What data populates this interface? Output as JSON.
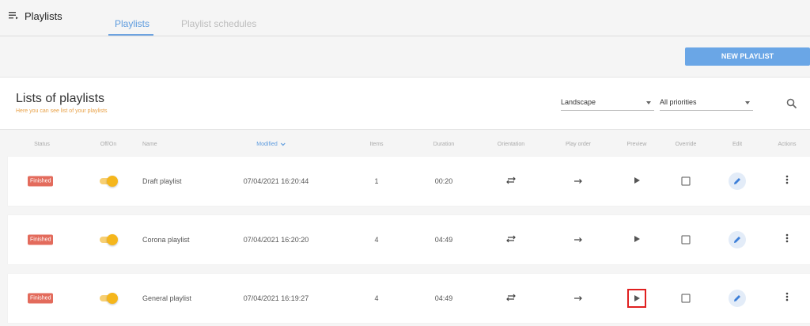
{
  "app": {
    "title": "Playlists"
  },
  "tabs": [
    {
      "label": "Playlists",
      "active": true
    },
    {
      "label": "Playlist schedules",
      "active": false
    }
  ],
  "toolbar": {
    "new_playlist_label": "NEW PLAYLIST"
  },
  "section": {
    "title": "Lists of playlists",
    "subtitle": "Here you can see list of your playlists"
  },
  "filters": {
    "orientation": "Landscape",
    "priority": "All priorities"
  },
  "columns": {
    "status": "Status",
    "onoff": "Off/On",
    "name": "Name",
    "modified": "Modified",
    "items": "Items",
    "duration": "Duration",
    "orientation": "Orientation",
    "play_order": "Play order",
    "preview": "Preview",
    "override": "Override",
    "edit": "Edit",
    "actions": "Actions"
  },
  "rows": [
    {
      "status": "Finished",
      "enabled": true,
      "name": "Draft playlist",
      "modified": "07/04/2021 16:20:44",
      "items": "1",
      "duration": "00:20",
      "override": false
    },
    {
      "status": "Finished",
      "enabled": true,
      "name": "Corona playlist",
      "modified": "07/04/2021 16:20:20",
      "items": "4",
      "duration": "04:49",
      "override": false
    },
    {
      "status": "Finished",
      "enabled": true,
      "name": "General playlist",
      "modified": "07/04/2021 16:19:27",
      "items": "4",
      "duration": "04:49",
      "override": false
    }
  ],
  "colors": {
    "accent": "#6aa6e6",
    "status_finished": "#e36b5c",
    "toggle_on": "#f5b61c",
    "subtitle": "#e8a045",
    "highlight": "#e02020"
  }
}
